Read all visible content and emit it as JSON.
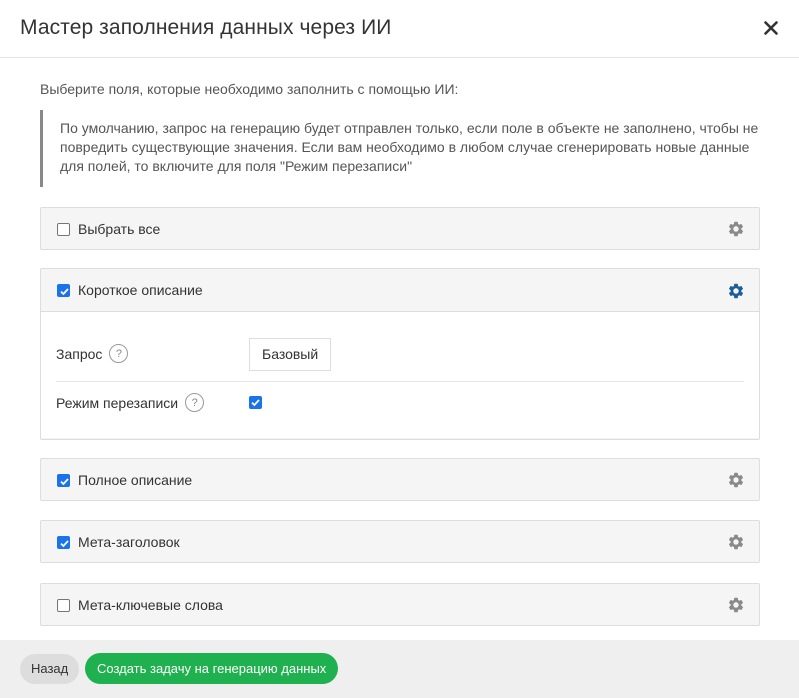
{
  "dialog": {
    "title": "Мастер заполнения данных через ИИ",
    "intro": "Выберите поля, которые необходимо заполнить с помощью ИИ:",
    "note": "По умолчанию, запрос на генерацию будет отправлен только, если поле в объекте не заполнено, чтобы не повредить существующие значения. Если вам необходимо в любом случае сгенерировать новые данные для полей, то включите для поля \"Режим перезаписи\""
  },
  "fields": {
    "select_all": {
      "label": "Выбрать все",
      "checked": false
    },
    "short_description": {
      "label": "Короткое описание",
      "checked": true,
      "request_label": "Запрос",
      "request_value": "Базовый",
      "overwrite_label": "Режим перезаписи",
      "overwrite_checked": true,
      "help_symbol": "?"
    },
    "full_description": {
      "label": "Полное описание",
      "checked": true
    },
    "meta_title": {
      "label": "Мета-заголовок",
      "checked": true
    },
    "meta_keywords": {
      "label": "Мета-ключевые слова",
      "checked": false
    }
  },
  "footer": {
    "back_label": "Назад",
    "create_label": "Создать задачу на генерацию данных"
  },
  "colors": {
    "accent_blue": "#1a73e8",
    "gear_active": "#1f5f99",
    "gear_inactive": "#8a8a8a",
    "create_button": "#1fb04f"
  },
  "icons": {
    "close": "close-icon",
    "gear": "gear-icon",
    "help": "help-icon",
    "check": "checkmark-icon"
  }
}
